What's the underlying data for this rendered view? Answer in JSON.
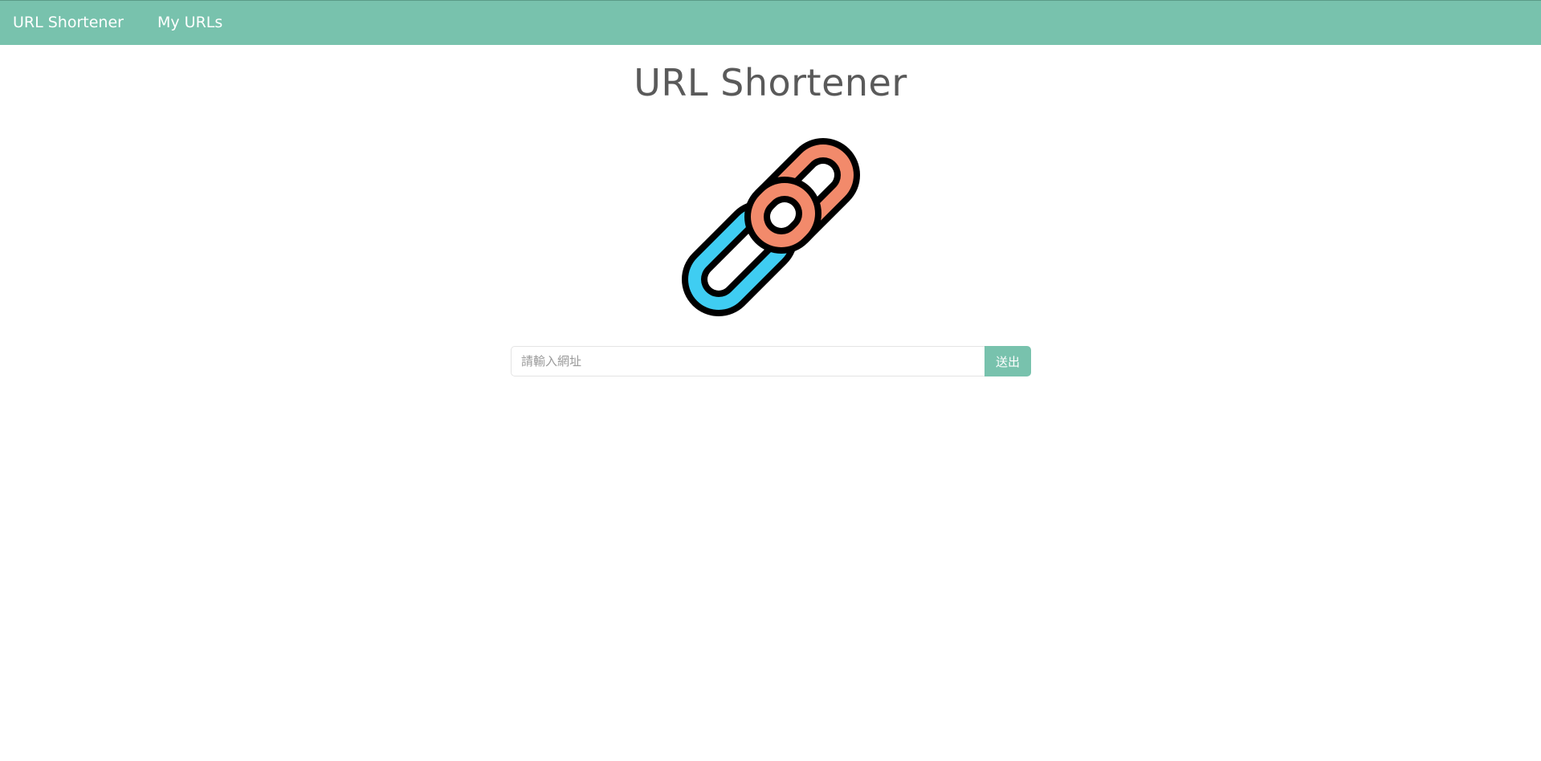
{
  "navbar": {
    "brand_label": "URL Shortener",
    "links": [
      {
        "label": "My URLs"
      }
    ],
    "background_color": "#78c2ad"
  },
  "main": {
    "title": "URL Shortener",
    "logo": {
      "icon": "chain-link-icon",
      "colors": [
        "#f28a6b",
        "#3fcdf2"
      ]
    },
    "form": {
      "url_input": {
        "value": "",
        "placeholder": "請輸入網址"
      },
      "submit_label": "送出"
    }
  }
}
